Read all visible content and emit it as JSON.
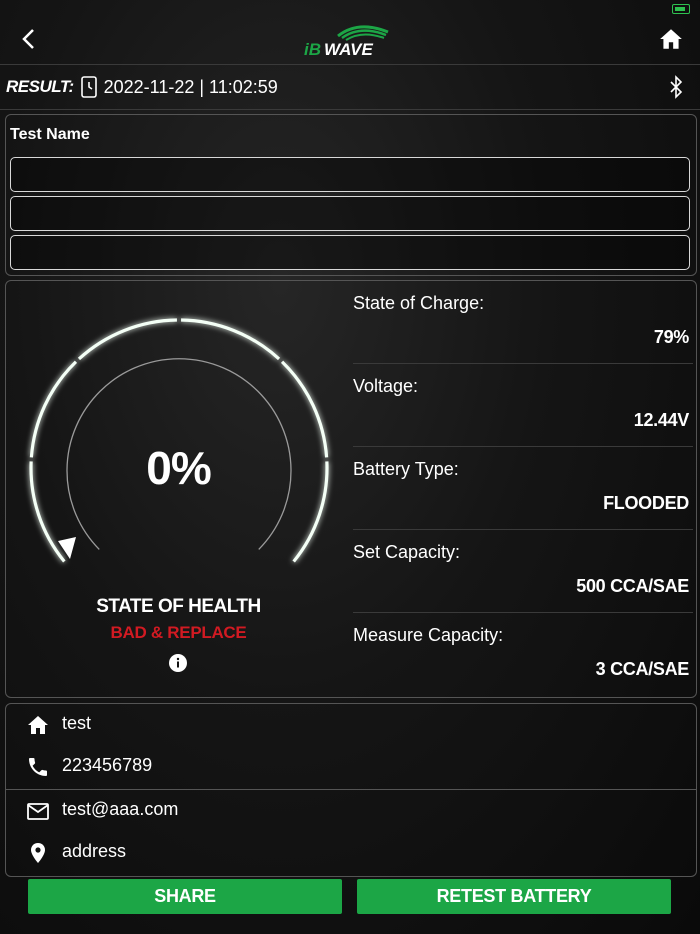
{
  "header": {
    "logo_text": "iBWAVE"
  },
  "result": {
    "label": "RESULT:",
    "datetime": "2022-11-22 | 11:02:59"
  },
  "test_name": {
    "label": "Test Name",
    "fields": [
      "",
      "",
      ""
    ]
  },
  "gauge": {
    "percent_text": "0%",
    "value": 0,
    "title": "STATE OF HEALTH",
    "status": "BAD & REPLACE",
    "status_color": "#d11a22"
  },
  "stats": [
    {
      "label": "State of Charge:",
      "value": "79%"
    },
    {
      "label": "Voltage:",
      "value": "12.44V"
    },
    {
      "label": "Battery Type:",
      "value": "FLOODED"
    },
    {
      "label": "Set Capacity:",
      "value": "500 CCA/SAE"
    },
    {
      "label": "Measure Capacity:",
      "value": "3 CCA/SAE"
    }
  ],
  "contact": {
    "name": "test",
    "phone": "223456789",
    "email": "test@aaa.com",
    "address": "address"
  },
  "buttons": {
    "share": "SHARE",
    "retest": "RETEST BATTERY"
  },
  "colors": {
    "accent_green": "#1ca646",
    "bad_red": "#d11a22",
    "background": "#0c0c0c"
  }
}
